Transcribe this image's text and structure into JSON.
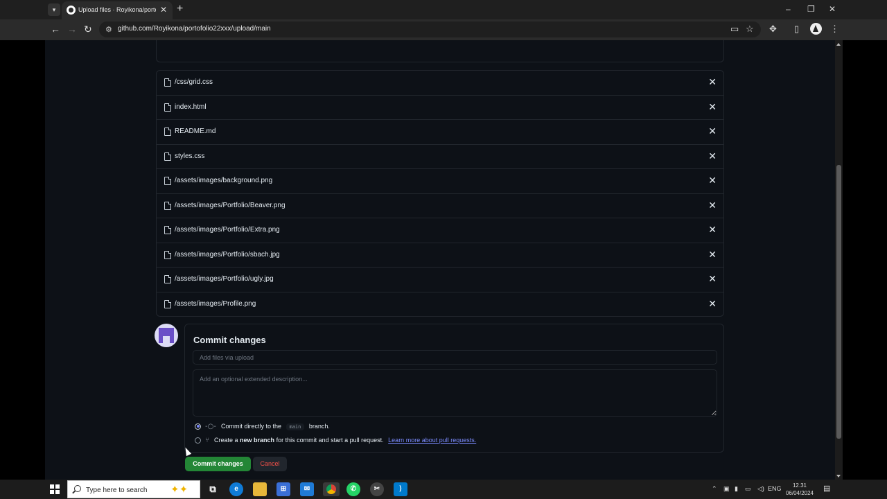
{
  "browser": {
    "tab_title": "Upload files · Royikona/portofolio",
    "url": "github.com/Royikona/portofolio22xxx/upload/main",
    "tab_close_glyph": "✕",
    "new_tab_glyph": "+",
    "icons": [
      "tab-search-icon",
      "github-favicon",
      "back-icon",
      "forward-icon",
      "reload-icon",
      "site-info-icon",
      "cast-icon",
      "star-icon",
      "extensions-icon",
      "side-panel-icon",
      "profile-icon",
      "more-icon",
      "minimize-icon",
      "maximize-icon",
      "close-icon"
    ]
  },
  "files": [
    {
      "name": "/css/grid.css"
    },
    {
      "name": "index.html"
    },
    {
      "name": "README.md"
    },
    {
      "name": "styles.css"
    },
    {
      "name": "/assets/images/background.png"
    },
    {
      "name": "/assets/images/Portfolio/Beaver.png"
    },
    {
      "name": "/assets/images/Portfolio/Extra.png"
    },
    {
      "name": "/assets/images/Portfolio/sbach.jpg"
    },
    {
      "name": "/assets/images/Portfolio/ugly.jpg"
    },
    {
      "name": "/assets/images/Profile.png"
    }
  ],
  "commit": {
    "title": "Commit changes",
    "summary_placeholder": "Add files via upload",
    "summary_value": "",
    "description_placeholder": "Add an optional extended description...",
    "description_value": "",
    "option_direct_prefix": "Commit directly to the",
    "option_direct_branch": "main",
    "option_direct_suffix": "branch.",
    "option_direct_checked": true,
    "option_new_prefix": "Create a",
    "option_new_bold": "new branch",
    "option_new_suffix": "for this commit and start a pull request.",
    "option_new_link": "Learn more about pull requests.",
    "option_new_checked": false,
    "accent_color": "#238636",
    "danger_color": "#f85149",
    "link_color": "#7c8cff"
  },
  "buttons": {
    "commit": "Commit changes",
    "cancel": "Cancel"
  },
  "taskbar": {
    "search_placeholder": "Type here to search",
    "language": "ENG",
    "time": "12.31",
    "date": "06/04/2024",
    "apps": [
      "task-view-icon",
      "edge-icon",
      "file-explorer-icon",
      "store-icon",
      "mail-icon",
      "chrome-icon",
      "whatsapp-icon",
      "snipping-tool-icon",
      "vscode-icon"
    ]
  }
}
